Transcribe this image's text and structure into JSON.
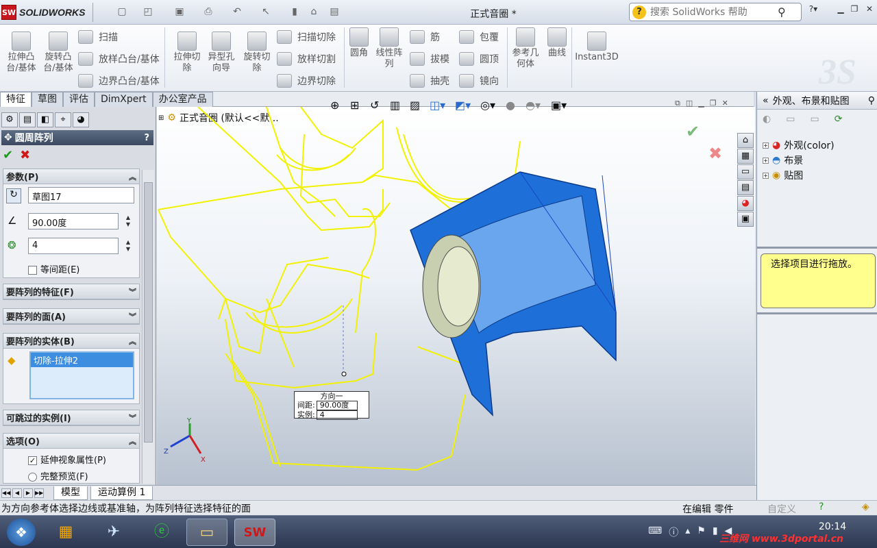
{
  "app": {
    "logo_text": "SOLIDWORKS",
    "doc_title": "正式音圈 *"
  },
  "search": {
    "placeholder": "搜索 SolidWorks 帮助"
  },
  "ribbon": {
    "extrude_boss": "拉伸凸台/基体",
    "revolve_boss": "旋转凸台/基体",
    "sweep": "扫描",
    "loft": "放样凸台/基体",
    "boundary": "边界凸台/基体",
    "extrude_cut": "拉伸切除",
    "hole_wizard": "异型孔向导",
    "revolve_cut": "旋转切除",
    "swept_cut": "扫描切除",
    "lofted_cut": "放样切割",
    "boundary_cut": "边界切除",
    "fillet": "圆角",
    "linear_pattern": "线性阵列",
    "rib": "筋",
    "draft": "拔模",
    "shell": "抽壳",
    "wrap": "包覆",
    "dome": "圆顶",
    "mirror": "镜向",
    "ref_geometry": "参考几何体",
    "curves": "曲线",
    "instant3d": "Instant3D"
  },
  "cm_tabs": [
    "特征",
    "草图",
    "评估",
    "DimXpert",
    "办公室产品"
  ],
  "property_manager": {
    "title": "圆周阵列",
    "help": "?",
    "params": {
      "label": "参数(P)",
      "sketch": "草图17",
      "angle": "90.00度",
      "count": "4",
      "equal_spacing": "等间距(E)"
    },
    "features": {
      "label": "要阵列的特征(F)"
    },
    "faces": {
      "label": "要阵列的面(A)"
    },
    "bodies": {
      "label": "要阵列的实体(B)",
      "item": "切除-拉伸2"
    },
    "skip": {
      "label": "可跳过的实例(I)"
    },
    "options": {
      "label": "选项(O)",
      "propagate": "延伸视象属性(P)",
      "full_preview": "完整预览(F)"
    }
  },
  "viewport": {
    "tree_label": "正式音圈 (默认<<默...",
    "callout": {
      "title": "方向一",
      "spacing_label": "间距:",
      "spacing": "90.00度",
      "instances_label": "实例:",
      "instances": "4"
    }
  },
  "right_panel": {
    "title": "外观、布景和贴图",
    "items": [
      "外观(color)",
      "布景",
      "贴图"
    ],
    "tip": "选择项目进行拖放。"
  },
  "bottom_tabs": [
    "模型",
    "运动算例 1"
  ],
  "status": {
    "message": "为方向参考体选择边线或基准轴，为阵列特征选择特征的面",
    "mode": "在编辑 零件",
    "custom": "自定义"
  },
  "taskbar": {
    "time": "20:14",
    "watermark": "三维网 www.3dportal.cn"
  },
  "colors": {
    "accent": "#1f6fd8",
    "selection": "#f0f000",
    "titlebar": "#3b4a60"
  }
}
